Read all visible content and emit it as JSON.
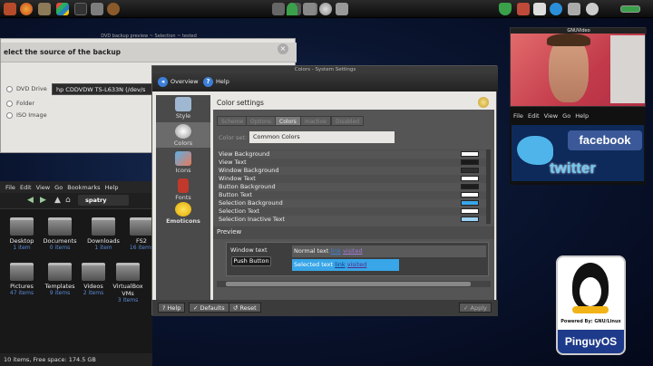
{
  "top_panel": {
    "clock": "",
    "left_icons": [
      "menu-icon",
      "firefox-icon",
      "gimp-icon",
      "windows-icon",
      "terminal-icon",
      "folder-icon",
      "bug-icon"
    ],
    "center_icons": [
      "app-icon",
      "app-icon",
      "app-icon",
      "palm-icon",
      "network-icon",
      "gear-icon",
      "tools-icon"
    ],
    "right_icons": [
      "shield-icon",
      "clipboard-icon",
      "update-icon",
      "skype-icon",
      "network-icon",
      "weather-icon",
      "battery-icon"
    ]
  },
  "backup_window": {
    "title": "DVD backup preview ~ Selection ~ tested",
    "heading": "elect the source of the backup",
    "options": [
      "DVD Drive",
      "Folder",
      "ISO Image"
    ],
    "device_value": "hp      CDDVDW TS-L633N (/dev/s"
  },
  "file_manager": {
    "menu": [
      "File",
      "Edit",
      "View",
      "Go",
      "Bookmarks",
      "Help"
    ],
    "path": "spatry",
    "folders": [
      {
        "name": "Desktop",
        "count": "1 item"
      },
      {
        "name": "Documents",
        "count": "0 items"
      },
      {
        "name": "Downloads",
        "count": "1 item"
      },
      {
        "name": "FS2",
        "count": "16 items"
      },
      {
        "name": "Pictures",
        "count": "47 items"
      },
      {
        "name": "Templates",
        "count": "9 items"
      },
      {
        "name": "Videos",
        "count": "2 items"
      },
      {
        "name": "VirtualBox VMs",
        "count": "3 items"
      }
    ],
    "status": "10 items, Free space: 174.5 GB"
  },
  "system_settings": {
    "title": "Colors - System Settings",
    "nav": {
      "overview": "Overview",
      "help": "Help"
    },
    "categories": [
      {
        "label": "Style",
        "icon": "style-icon"
      },
      {
        "label": "Colors",
        "icon": "colors-icon"
      },
      {
        "label": "Icons",
        "icon": "icons-icon"
      },
      {
        "label": "Fonts",
        "icon": "fonts-icon"
      },
      {
        "label": "Emoticons",
        "icon": "emoticons-icon"
      }
    ],
    "heading": "Color settings",
    "tabs": [
      "Scheme",
      "Options",
      "Colors",
      "Inactive",
      "Disabled"
    ],
    "color_set_label": "Color set:",
    "color_set_value": "Common Colors",
    "color_rows": [
      {
        "label": "View Background",
        "color": "#ffffff"
      },
      {
        "label": "View Text",
        "color": "#1a1a1a"
      },
      {
        "label": "Window Background",
        "color": "#2e2e2e"
      },
      {
        "label": "Window Text",
        "color": "#ffffff"
      },
      {
        "label": "Button Background",
        "color": "#1c1c1c"
      },
      {
        "label": "Button Text",
        "color": "#ffffff"
      },
      {
        "label": "Selection Background",
        "color": "#38a6e8"
      },
      {
        "label": "Selection Text",
        "color": "#ffffff"
      },
      {
        "label": "Selection Inactive Text",
        "color": "#9ad2f4"
      }
    ],
    "preview": {
      "heading": "Preview",
      "window_text": "Window text",
      "push_button": "Push Button",
      "normal_text": "Normal text",
      "link": "link",
      "visited": "visited",
      "selected_text": "Selected text"
    },
    "buttons": {
      "help": "Help",
      "defaults": "Defaults",
      "reset": "Reset",
      "apply": "Apply"
    }
  },
  "webcam": {
    "title": "GNUVideo"
  },
  "social_widget": {
    "menu": [
      "File",
      "Edit",
      "View",
      "Go",
      "Help"
    ],
    "facebook": "facebook",
    "twitter": "twitter"
  },
  "pinguy": {
    "powered_by": "Powered By: GNU/Linux",
    "name": "PinguyOS"
  }
}
